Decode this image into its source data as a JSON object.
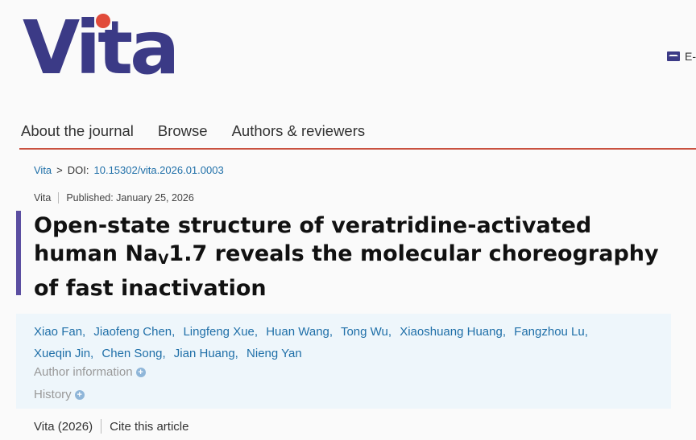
{
  "logo": {
    "text": "Vita",
    "accent": "#e14b3a",
    "brand": "#3b3a86"
  },
  "header": {
    "email_label": "E-",
    "email_icon": "envelope-icon"
  },
  "nav": {
    "items": [
      "About the journal",
      "Browse",
      "Authors & reviewers"
    ],
    "underline_color": "#c9513f"
  },
  "breadcrumb": {
    "home": "Vita",
    "separator": ">",
    "doi_label": "DOI:",
    "doi": "10.15302/vita.2026.01.0003"
  },
  "publication": {
    "journal": "Vita",
    "published": "Published: January 25, 2026"
  },
  "article": {
    "title_part1": "Open-state structure of veratridine-activated human Na",
    "title_sub": "V",
    "title_part2": "1.7 reveals the molecular choreography of fast inactivation"
  },
  "authors": [
    "Xiao Fan,",
    "Jiaofeng Chen,",
    "Lingfeng Xue,",
    "Huan Wang,",
    "Tong Wu,",
    "Xiaoshuang Huang,",
    "Fangzhou Lu,",
    "Xueqin Jin,",
    "Chen Song,",
    "Jian Huang,",
    "Nieng Yan"
  ],
  "sections": {
    "author_info": "Author information",
    "history": "History",
    "expand_icon": "plus-icon"
  },
  "footer": {
    "citation": "Vita (2026)",
    "cite": "Cite this article"
  }
}
